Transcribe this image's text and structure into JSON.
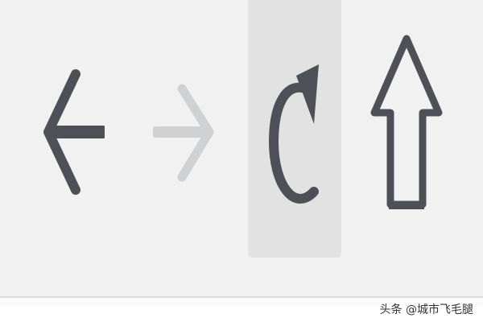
{
  "toolbar": {
    "buttons": [
      {
        "id": "back",
        "icon": "arrow-left-icon",
        "enabled": true
      },
      {
        "id": "forward",
        "icon": "arrow-right-icon",
        "enabled": false
      },
      {
        "id": "reload",
        "icon": "refresh-icon",
        "enabled": true,
        "hovered": true
      },
      {
        "id": "up",
        "icon": "arrow-up-icon",
        "enabled": true
      }
    ]
  },
  "colors": {
    "toolbar_bg": "#f1f1f1",
    "icon_active": "#4d5157",
    "icon_disabled": "#cfd1d3",
    "hover_bg": "#e2e2e2"
  },
  "watermark": {
    "text": "头条 @城市飞毛腿"
  }
}
